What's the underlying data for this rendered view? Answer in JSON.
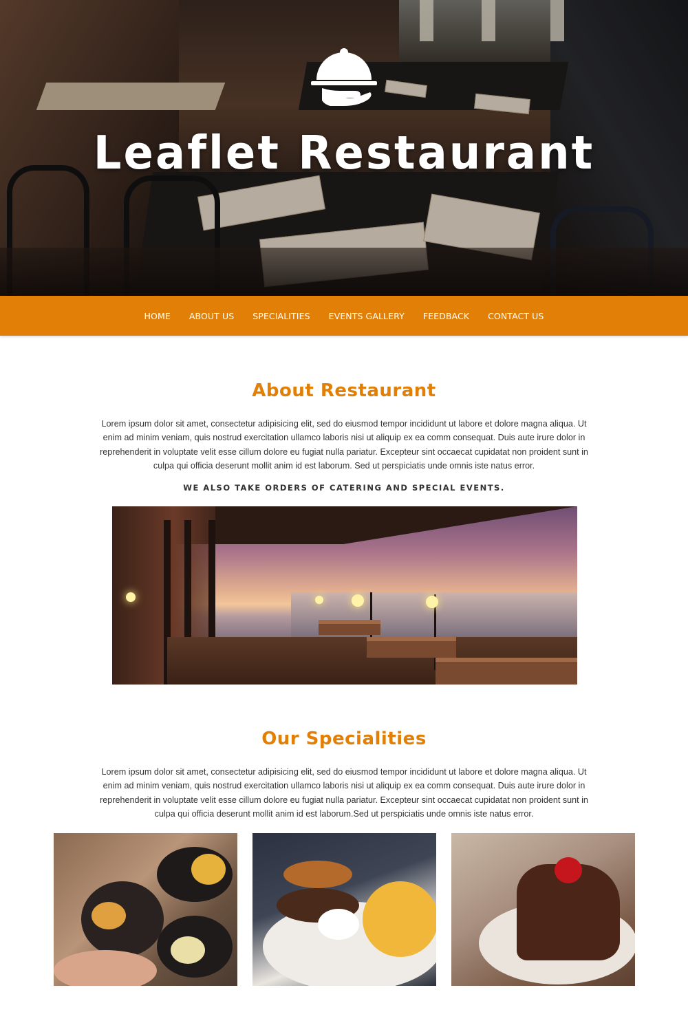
{
  "hero": {
    "title": "Leaflet Restaurant",
    "logo_icon": "cloche-serving-hand-icon",
    "background_image": "restaurant-interior-photo"
  },
  "nav": {
    "items": [
      {
        "label": "HOME"
      },
      {
        "label": "ABOUT US"
      },
      {
        "label": "SPECIALITIES"
      },
      {
        "label": "EVENTS GALLERY"
      },
      {
        "label": "FEEDBACK"
      },
      {
        "label": "CONTACT US"
      }
    ]
  },
  "about": {
    "title": "About Restaurant",
    "text": "Lorem ipsum dolor sit amet, consectetur adipisicing elit, sed do eiusmod tempor incididunt ut labore et dolore magna aliqua. Ut enim ad minim veniam, quis nostrud exercitation ullamco laboris nisi ut aliquip ex ea comm consequat. Duis aute irure dolor in reprehenderit in voluptate velit esse cillum dolore eu fugiat nulla pariatur. Excepteur sint occaecat cupidatat non proident sunt in culpa qui officia deserunt mollit anim id est laborum. Sed ut perspiciatis unde omnis iste natus error.",
    "tagline": "WE ALSO TAKE ORDERS OF CATERING AND SPECIAL EVENTS.",
    "image": "seaside-terrace-sunset-photo"
  },
  "specialities": {
    "title": "Our Specialities",
    "text": "Lorem ipsum dolor sit amet, consectetur adipisicing elit, sed do eiusmod tempor incididunt ut labore et dolore magna aliqua. Ut enim ad minim veniam, quis nostrud exercitation ullamco laboris nisi ut aliquip ex ea comm consequat. Duis aute irure dolor in reprehenderit in voluptate velit esse cillum dolore eu fugiat nulla pariatur. Excepteur sint occaecat cupidatat non proident sunt in culpa qui officia deserunt mollit anim id est laborum.Sed ut perspiciatis unde omnis iste natus error.",
    "images": [
      "snack-platters-photo",
      "burger-and-fries-photo",
      "chocolate-cake-slice-photo"
    ]
  },
  "colors": {
    "accent": "#e17f06",
    "nav_text": "#ffffff",
    "body_text": "#333333"
  }
}
